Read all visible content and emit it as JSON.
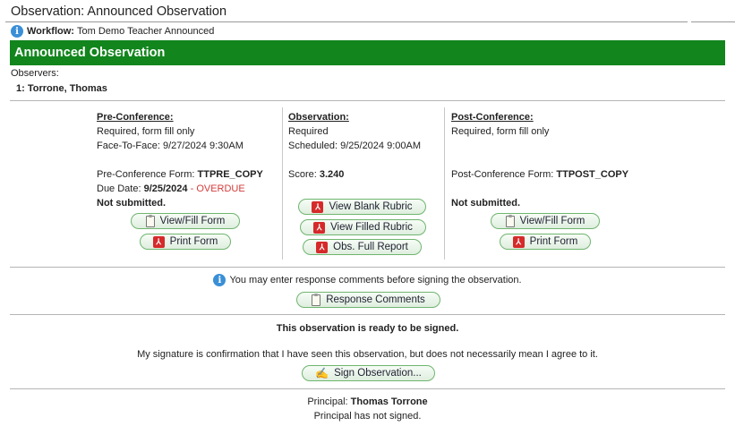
{
  "header": {
    "title": "Observation: Announced Observation"
  },
  "workflow": {
    "label": "Workflow:",
    "value": "Tom Demo Teacher Announced"
  },
  "banner": {
    "title": "Announced Observation"
  },
  "observers": {
    "label": "Observers:",
    "items": [
      "1: Torrone, Thomas"
    ]
  },
  "pre_conference": {
    "heading": "Pre-Conference:",
    "line1": "Required, form fill only",
    "line2": "Face-To-Face: 9/27/2024 9:30AM",
    "form_label": "Pre-Conference Form:",
    "form_value": "TTPRE_COPY",
    "due_label": "Due Date:",
    "due_value": "9/25/2024",
    "overdue": "- OVERDUE",
    "status": "Not submitted.",
    "view_fill_label": "View/Fill Form",
    "print_label": "Print Form"
  },
  "observation": {
    "heading": "Observation:",
    "line1": "Required",
    "line2": "Scheduled: 9/25/2024 9:00AM",
    "score_label": "Score:",
    "score_value": "3.240",
    "view_blank_label": "View Blank Rubric",
    "view_filled_label": "View Filled Rubric",
    "full_report_label": "Obs. Full Report"
  },
  "post_conference": {
    "heading": "Post-Conference:",
    "line1": "Required, form fill only",
    "form_label": "Post-Conference Form:",
    "form_value": "TTPOST_COPY",
    "status": "Not submitted.",
    "view_fill_label": "View/Fill Form",
    "print_label": "Print Form"
  },
  "response": {
    "info": "You may enter response comments before signing the observation.",
    "button_label": "Response Comments"
  },
  "sign": {
    "ready": "This observation is ready to be signed.",
    "confirmation": "My signature is confirmation that I have seen this observation, but does not necessarily mean I agree to it.",
    "button_label": "Sign Observation..."
  },
  "principal": {
    "label": "Principal:",
    "name": "Thomas Torrone",
    "status": "Principal has not signed."
  },
  "colors": {
    "banner": "#12851d",
    "overdue": "#d43b3b",
    "info": "#3a8fd6",
    "pdf": "#d62a2a"
  }
}
